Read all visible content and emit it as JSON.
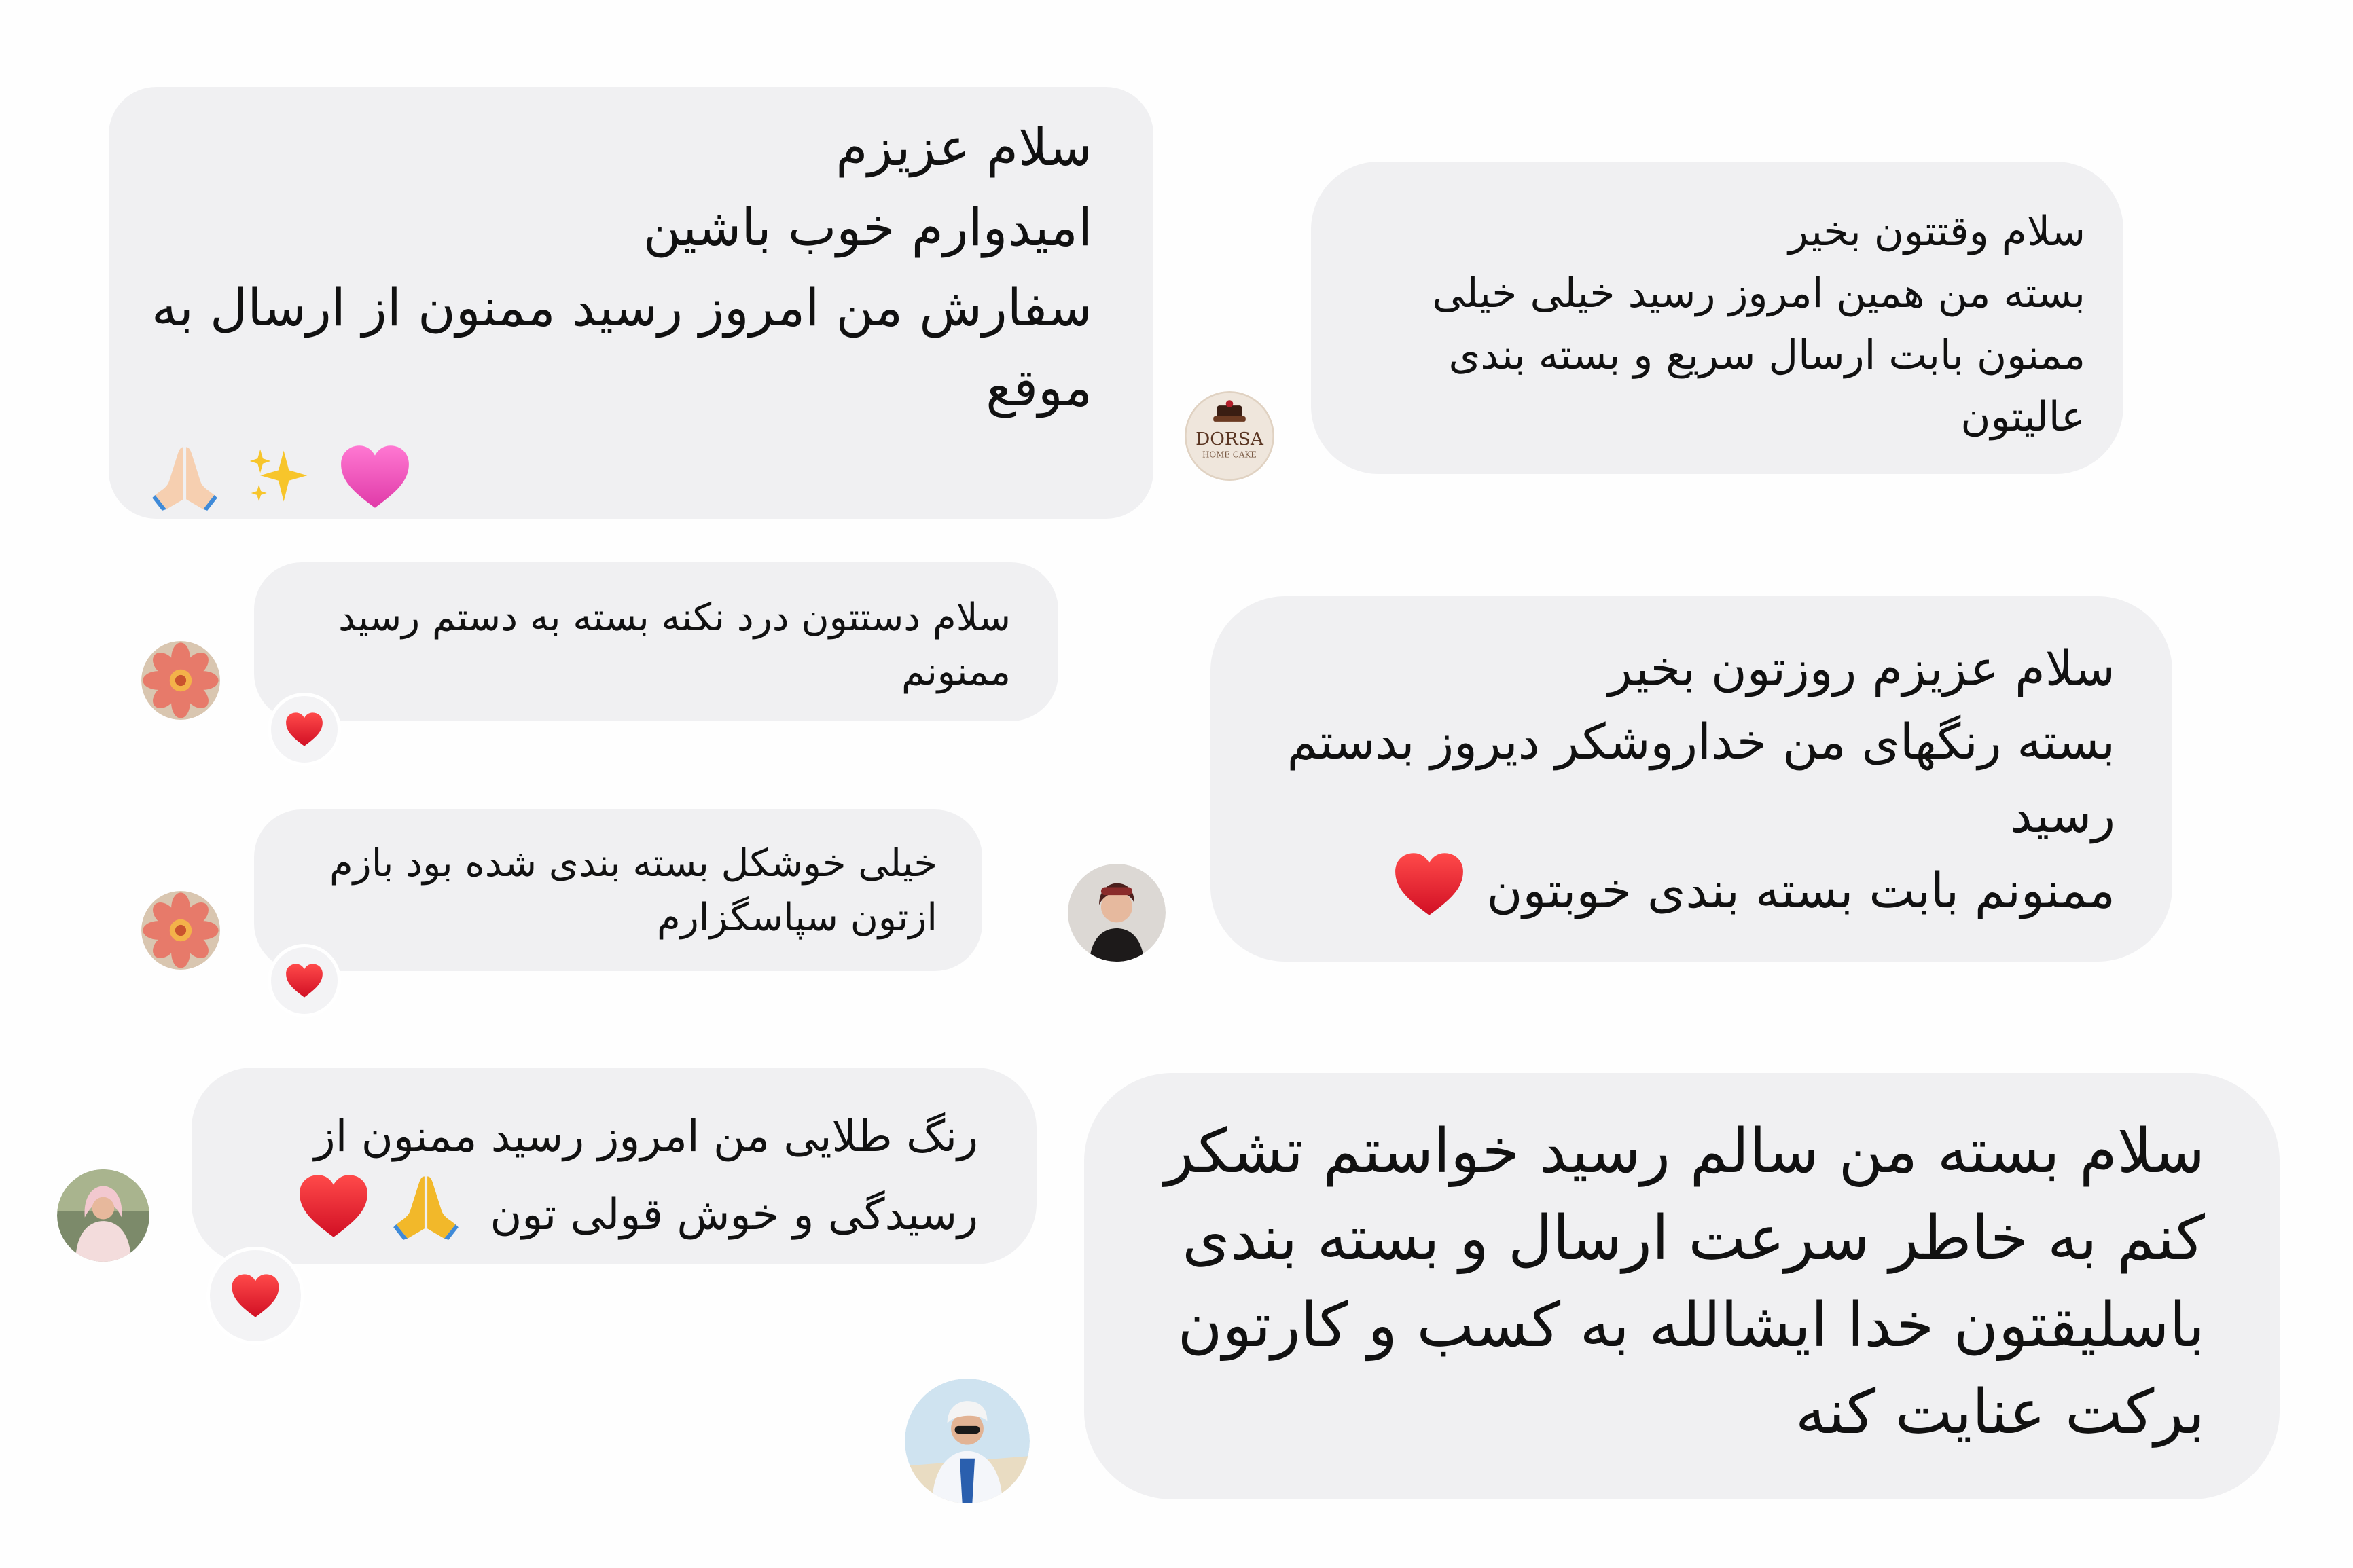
{
  "messages": [
    {
      "lines": [
        "سلام عزیزم",
        "امیدوارم خوب باشین",
        "سفارش من امروز رسید  ممنون از ارسال به",
        "موقع"
      ],
      "emojis": [
        "folded-hands",
        "sparkles",
        "pink-heart"
      ]
    },
    {
      "lines": [
        "سلام وقتتون بخیر",
        "بسته من همین امروز رسید خیلی خیلی",
        "ممنون بابت ارسال سریع و بسته بندی",
        "عالیتون"
      ]
    },
    {
      "lines": [
        "سلام دستتون درد نکنه بسته به دستم رسید",
        "ممنونم"
      ],
      "reaction": "red-heart"
    },
    {
      "lines": [
        "خیلی خوشکل بسته بندی شده بود بازم",
        "ازتون سپاسگزارم"
      ],
      "reaction": "red-heart"
    },
    {
      "lines": [
        "سلام عزیزم روزتون بخیر",
        "بسته رنگهای من خداروشکر دیروز بدستم",
        "رسید",
        "ممنونم بابت بسته بندی خوبتون"
      ],
      "emojis": [
        "red-heart"
      ]
    },
    {
      "lines": [
        "رنگ طلایی من امروز رسید ممنون از",
        "رسیدگی و خوش قولی تون"
      ],
      "emojis": [
        "folded-hands",
        "red-heart"
      ],
      "reaction": "red-heart"
    },
    {
      "lines": [
        "سلام بسته من سالم رسید خواستم تشکر",
        "کنم به خاطر سرعت ارسال و بسته بندی",
        "باسلیقتون خدا ایشالله به کسب و کارتون",
        "برکت عنایت کنه"
      ]
    }
  ],
  "avatars": [
    {
      "icon": "cake-logo-avatar",
      "logo_text": "DORSA",
      "logo_subtext": "HOME CAKE"
    },
    {
      "icon": "flower-avatar"
    },
    {
      "icon": "flower-avatar"
    },
    {
      "icon": "woman-portrait-avatar"
    },
    {
      "icon": "woman-portrait-avatar"
    },
    {
      "icon": "woman-portrait-avatar"
    }
  ],
  "colors": {
    "bubble": "#f0f0f2",
    "text": "#111111",
    "heart_red": "#e0142c",
    "heart_pink": "#f050b8"
  }
}
